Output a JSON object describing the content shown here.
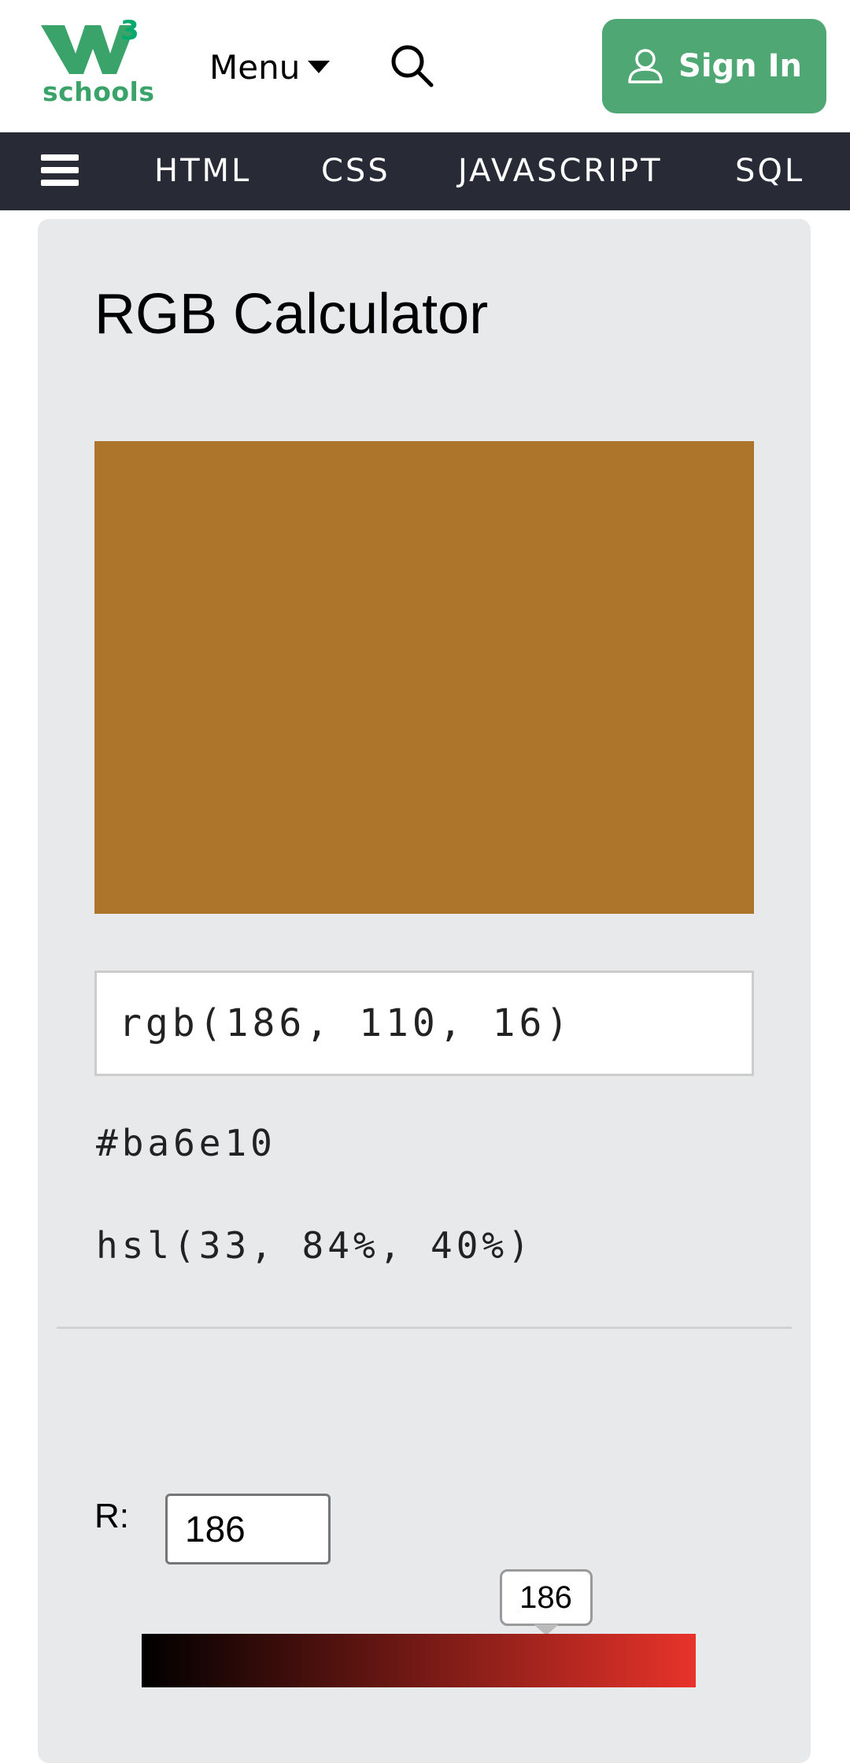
{
  "header": {
    "logo_superscript": "3",
    "logo_text": "schools",
    "menu_label": "Menu",
    "search_icon": "search-icon",
    "signin_label": "Sign In",
    "signin_icon": "user-icon",
    "brand_color": "#04aa6d",
    "signin_color": "#4fa774"
  },
  "nav": {
    "background": "#282a35",
    "items": [
      {
        "label": "HTML"
      },
      {
        "label": "CSS"
      },
      {
        "label": "JAVASCRIPT"
      },
      {
        "label": "SQL"
      }
    ]
  },
  "calculator": {
    "title": "RGB Calculator",
    "swatch_color": "#ad742c",
    "rgb_value": "rgb(186, 110, 16)",
    "hex_value": "#ba6e10",
    "hsl_value": "hsl(33, 84%, 40%)",
    "red": {
      "label": "R:",
      "value": "186",
      "min": 0,
      "max": 255,
      "slider_start_color": "#000000",
      "slider_end_color": "#e8332a"
    }
  }
}
